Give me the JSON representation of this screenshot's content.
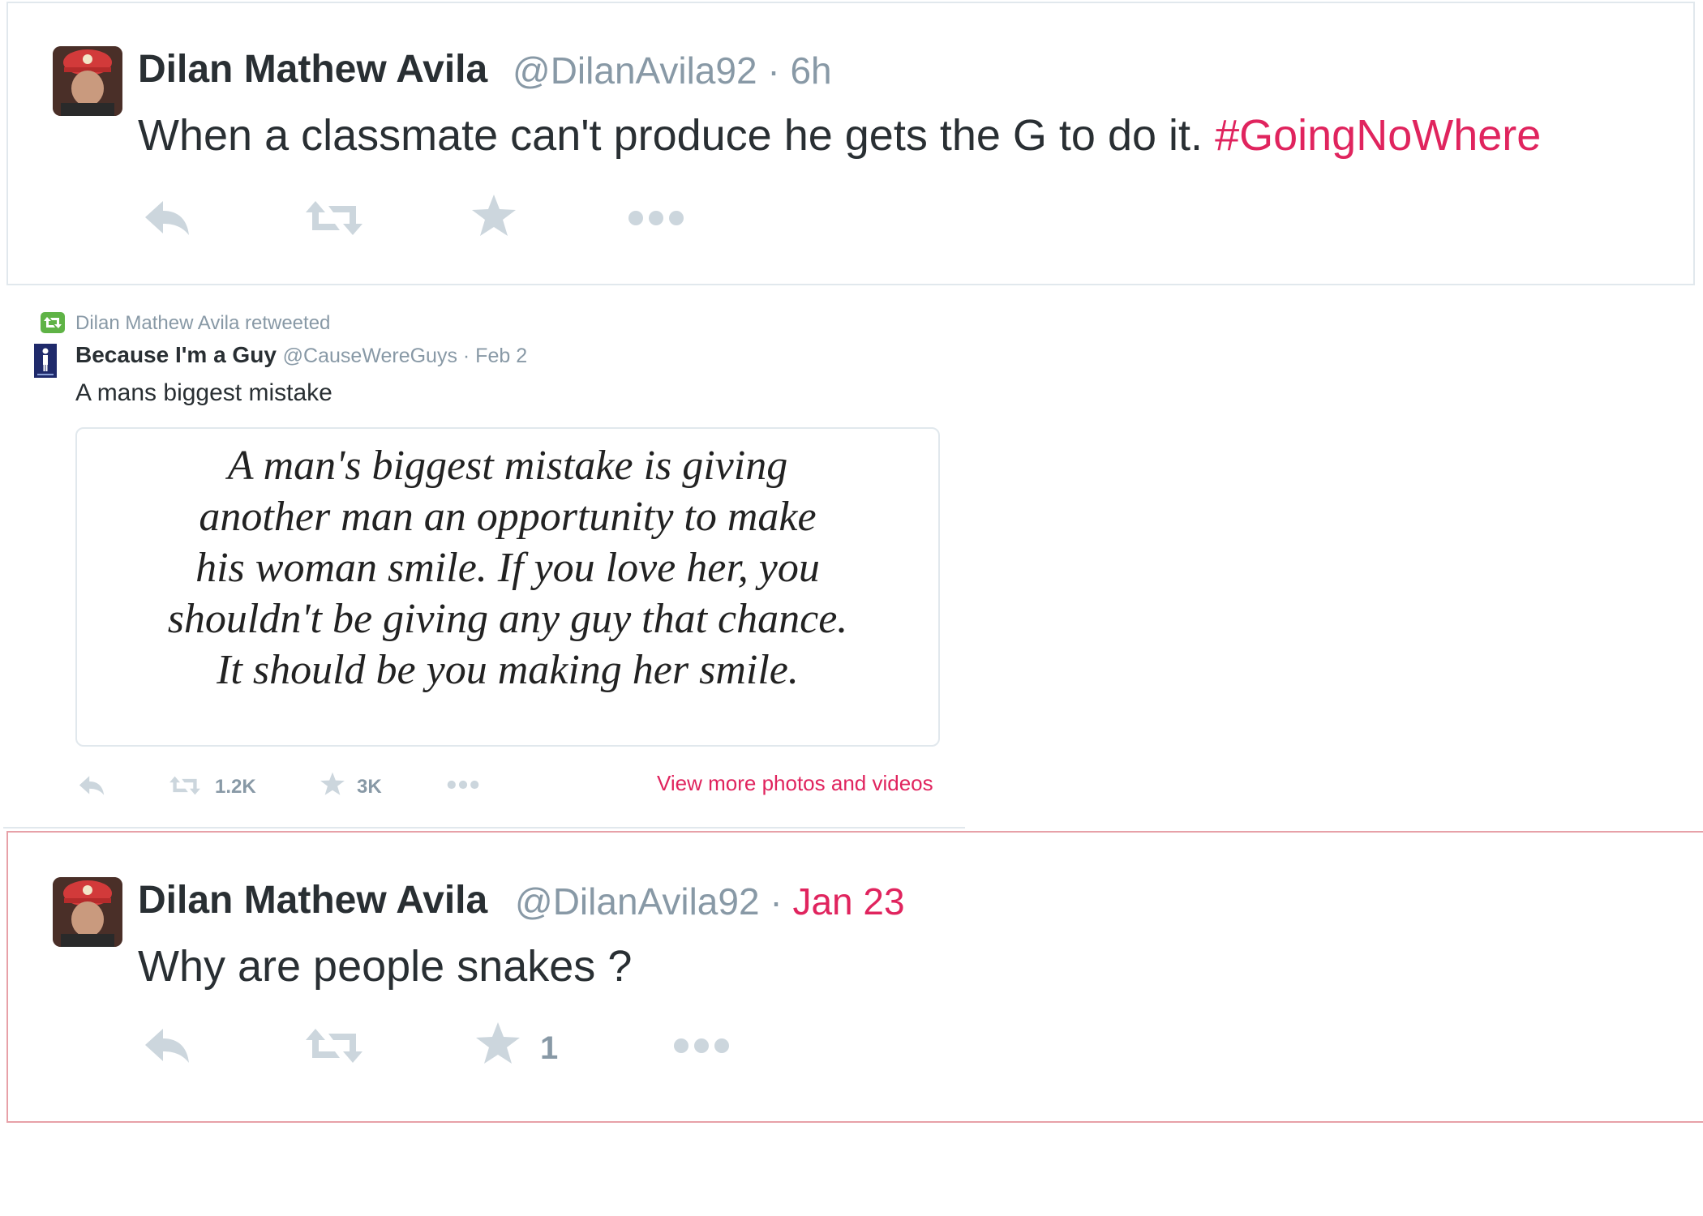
{
  "tweet1": {
    "name": "Dilan Mathew Avila",
    "handle": "@DilanAvila92",
    "time": "6h",
    "text": "When a classmate can't produce he gets the G to do it.",
    "hashtag": "#GoingNoWhere"
  },
  "retweet": {
    "context": "Dilan Mathew Avila retweeted",
    "name": "Because I'm a Guy",
    "handle": "@CauseWereGuys",
    "time": "Feb 2",
    "text": "A mans biggest mistake",
    "image_lines": [
      "A man's biggest mistake is giving",
      "another man an opportunity to make",
      "his woman smile. If you love her, you",
      "shouldn't be giving any guy that chance.",
      "It should be you making her smile."
    ],
    "retweets": "1.2K",
    "favorites": "3K",
    "more_link": "View more photos and videos"
  },
  "tweet3": {
    "name": "Dilan Mathew Avila",
    "handle": "@DilanAvila92",
    "time": "Jan 23",
    "text": "Why are people snakes ?",
    "favorites": "1"
  },
  "colors": {
    "icon_gray": "#ccd6dd",
    "text_gray": "#8899a6",
    "accent_red": "#e0245e",
    "retweet_green": "#5fb346",
    "highlight_border": "#e7a1a8"
  }
}
